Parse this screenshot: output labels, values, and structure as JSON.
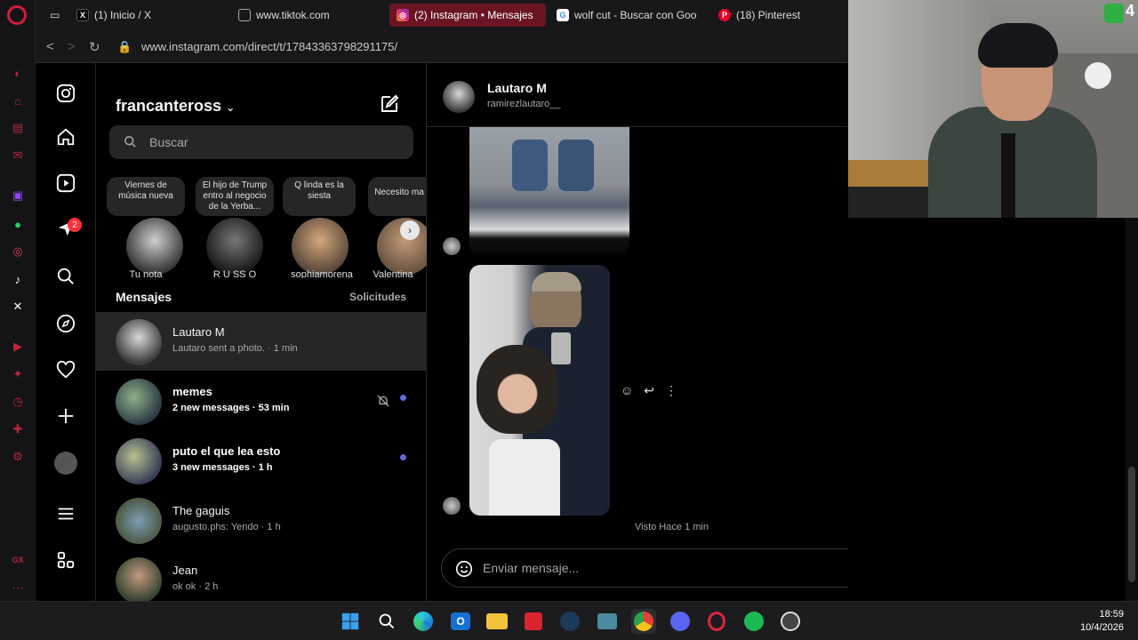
{
  "tabs": [
    {
      "label": "(1) Inicio / X",
      "icon": "x-icon"
    },
    {
      "label": "www.tiktok.com",
      "icon": "page-icon"
    },
    {
      "label": "(2) Instagram • Mensajes",
      "icon": "instagram-icon",
      "active": true
    },
    {
      "label": "wolf cut - Buscar con Goo",
      "icon": "google-icon"
    },
    {
      "label": "(18) Pinterest",
      "icon": "pinterest-icon"
    }
  ],
  "url": "www.instagram.com/direct/t/17843363798291175/",
  "inbox": {
    "username": "francanteross",
    "search_placeholder": "Buscar",
    "notes": [
      {
        "text": "Viernes de música nueva",
        "name": "Tu nota"
      },
      {
        "text": "El hijo de Trump entro al negocio de la Yerba...",
        "name": "R U SS O"
      },
      {
        "text": "Q linda es la siesta",
        "name": "sophiamorena"
      },
      {
        "text": "Necesito ma",
        "name": "Valentina"
      }
    ],
    "section_title": "Mensajes",
    "requests_label": "Solicitudes",
    "conversations": [
      {
        "name": "Lautaro M",
        "snippet": "Lautaro sent a photo. · 1 min"
      },
      {
        "name": "memes",
        "snippet": "2 new messages · 53 min"
      },
      {
        "name": "puto el que lea esto",
        "snippet": "3 new messages · 1 h"
      },
      {
        "name": "The gaguis",
        "snippet": "augusto.phs: Yendo · 1 h"
      },
      {
        "name": "Jean",
        "snippet": "ok ok · 2 h"
      }
    ]
  },
  "nav_badge": "2",
  "thread": {
    "name": "Lautaro M",
    "handle": "ramirezlautaro__",
    "seen": "Visto Hace 1 min",
    "composer_placeholder": "Enviar mensaje..."
  },
  "clock": {
    "time": "18:59",
    "date": "10/4/2026"
  },
  "colors": {
    "accent": "#d01e37",
    "unread_dot": "#5e6bd8",
    "ig_bg": "#000000"
  }
}
